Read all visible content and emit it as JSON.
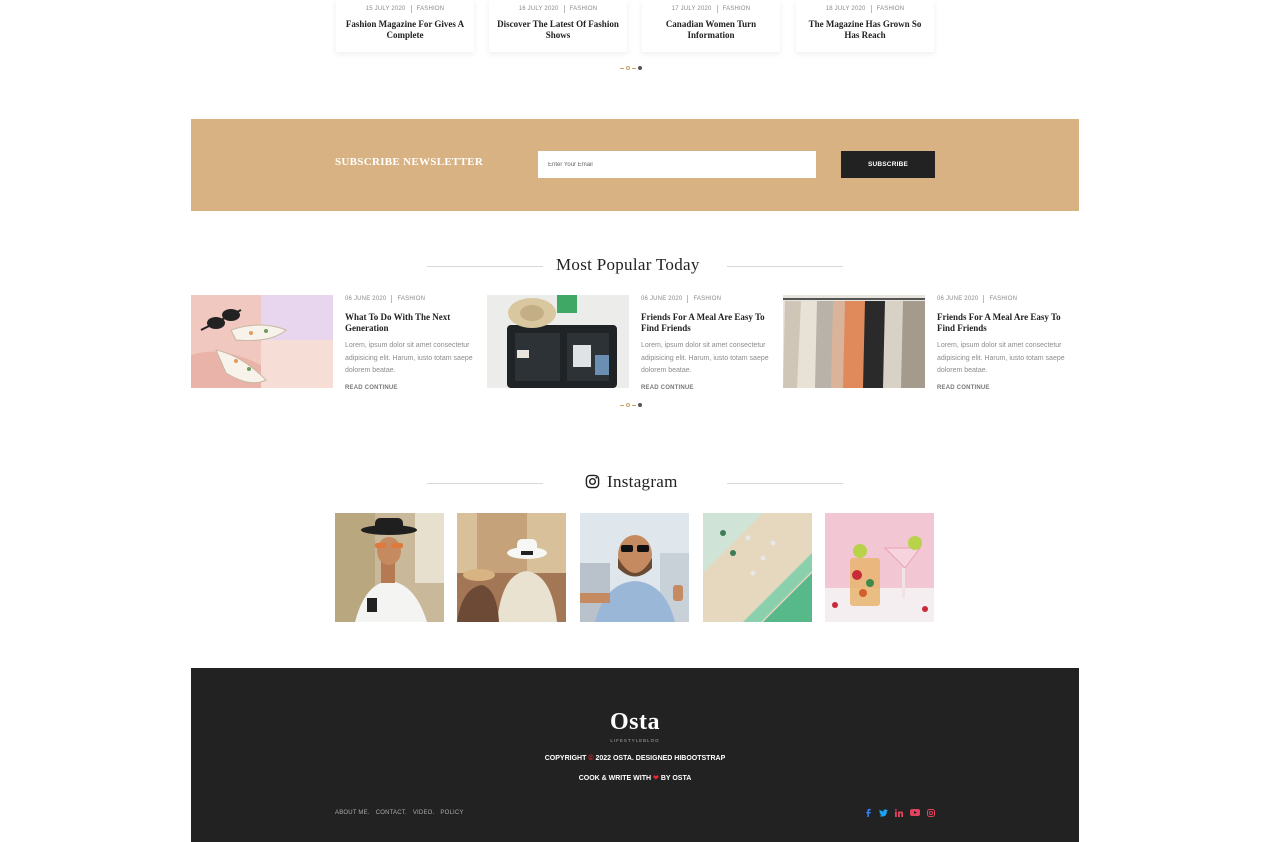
{
  "top_cards": [
    {
      "date": "15 JULY 2020",
      "category": "FASHION",
      "title": "Fashion Magazine For Gives A Complete"
    },
    {
      "date": "16 JULY 2020",
      "category": "FASHION",
      "title": "Discover The Latest Of Fashion Shows"
    },
    {
      "date": "17 JULY 2020",
      "category": "FASHION",
      "title": "Canadian Women Turn Information"
    },
    {
      "date": "18 JULY 2020",
      "category": "FASHION",
      "title": "The Magazine Has Grown So Has Reach"
    }
  ],
  "newsletter": {
    "title": "SUBSCRIBE NEWSLETTER",
    "placeholder": "Enter Your Email",
    "button": "SUBSCRIBE",
    "bg_color": "#d8b282"
  },
  "popular": {
    "heading": "Most Popular Today",
    "items": [
      {
        "date": "06 JUNE 2020",
        "category": "FASHION",
        "title": "What To Do With The Next Generation",
        "excerpt": "Lorem, ipsum dolor sit amet consectetur adipisicing elit. Harum, iusto totam saepe dolorem beatae.",
        "link": "READ CONTINUE",
        "image": "sunglasses-shoes-photo"
      },
      {
        "date": "06 JUNE 2020",
        "category": "FASHION",
        "title": "Friends For A Meal Are Easy To Find Friends",
        "excerpt": "Lorem, ipsum dolor sit amet consectetur adipisicing elit. Harum, iusto totam saepe dolorem beatae.",
        "link": "READ CONTINUE",
        "image": "travel-suitcase-photo"
      },
      {
        "date": "06 JUNE 2020",
        "category": "FASHION",
        "title": "Friends For A Meal Are Easy To Find Friends",
        "excerpt": "Lorem, ipsum dolor sit amet consectetur adipisicing elit. Harum, iusto totam saepe dolorem beatae.",
        "link": "READ CONTINUE",
        "image": "clothes-rack-photo"
      }
    ]
  },
  "instagram": {
    "heading": "Instagram",
    "icon": "instagram-icon",
    "images": [
      "man-with-hat-phone",
      "travelers-hats",
      "man-selfie-thumbs-up",
      "beach-aerial",
      "cocktail-drinks"
    ]
  },
  "footer": {
    "logo": "Osta",
    "tagline": "LIFESTYLEBLOG",
    "copyright_prefix": "COPYRIGHT",
    "copyright_suffix": "2022 OSTA. DESIGNED HIBOOTSTRAP",
    "credit_prefix": "COOK & WRITE WITH",
    "credit_suffix": "BY OSTA",
    "nav": [
      "ABOUT ME.",
      "CONTACT.",
      "VIDEO.",
      "POLICY"
    ],
    "social": [
      "facebook-icon",
      "twitter-icon",
      "linkedin-icon",
      "youtube-icon",
      "instagram-icon"
    ]
  },
  "colors": {
    "accent": "#c9a36c",
    "dark": "#222222",
    "heart": "#e32b2b",
    "facebook": "#3b5998",
    "twitter": "#1da1f2",
    "linkedin": "#e4405f",
    "youtube": "#e4405f",
    "instagram": "#e4405f"
  }
}
